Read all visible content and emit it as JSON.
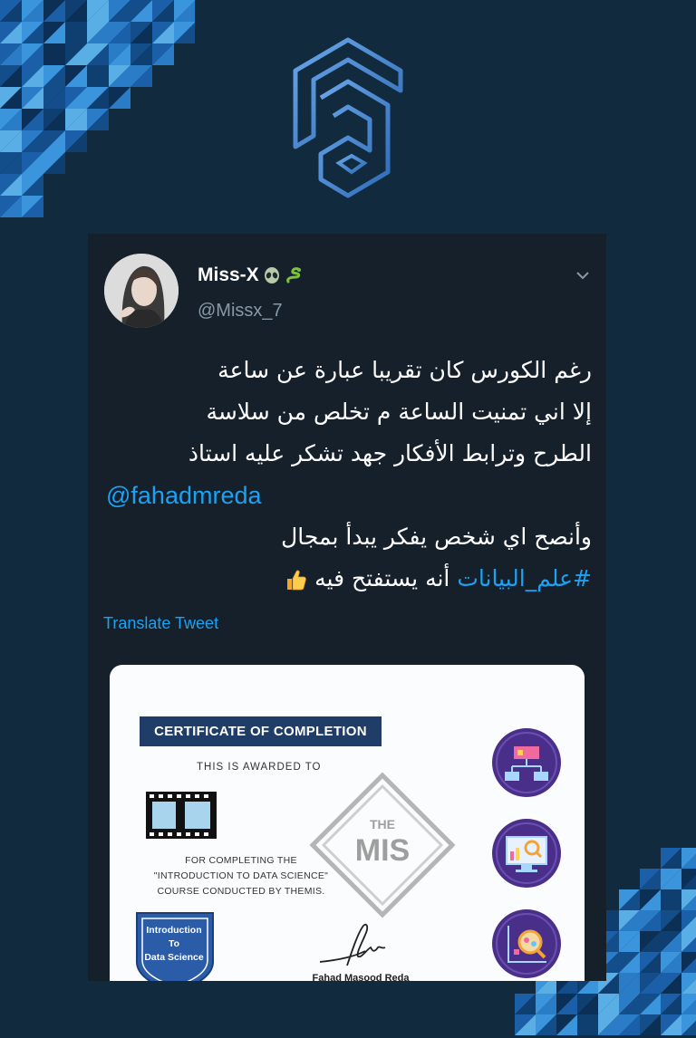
{
  "colors": {
    "background": "#122a3d",
    "tweet_bg": "#15202b",
    "link": "#1da1f2",
    "muted": "#8899a6",
    "certificate_banner": "#1f3d66",
    "icon_circle": "#4a2f8a"
  },
  "logo": {
    "icon": "fa-brand-logo"
  },
  "tweet": {
    "author": {
      "name": "Miss-X",
      "emojis": [
        "alien-emoji",
        "snake-emoji"
      ],
      "handle": "@Missx_7"
    },
    "menu_icon": "chevron-down-icon",
    "text_lines": [
      "رغم الكورس كان تقريبا عبارة عن ساعة",
      "إلا اني تمنيت الساعة م تخلص من سلاسة",
      "الطرح وترابط الأفكار جهد تشكر عليه استاذ"
    ],
    "mention": "@fahadmreda",
    "text_line_after": "وأنصح اي شخص يفكر يبدأ بمجال",
    "hashtag": "#علم_البيانات",
    "text_tail": "أنه يستفتح فيه",
    "tail_emoji": "thumbs-up-emoji",
    "translate_label": "Translate Tweet"
  },
  "certificate": {
    "title": "CERTIFICATE OF COMPLETION",
    "awarded": "THIS IS AWARDED  TO",
    "completing_lines": [
      "FOR COMPLETING THE",
      "\"INTRODUCTION TO DATA SCIENCE\"",
      "COURSE CONDUCTED BY THEMIS."
    ],
    "badge_lines": [
      "Introduction",
      "To",
      "Data Science"
    ],
    "logo_the": "THE",
    "logo_main": "MIS",
    "signer": "Fahad Masood Reda",
    "side_icons": [
      "flowchart-icon",
      "monitor-analytics-icon",
      "magnify-chart-icon"
    ]
  }
}
